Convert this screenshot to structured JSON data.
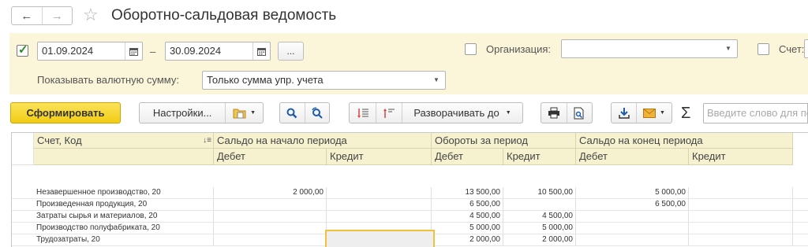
{
  "window": {
    "title": "Оборотно-сальдовая ведомость",
    "back_icon": "←",
    "forward_icon": "→",
    "star_icon": "☆"
  },
  "filters": {
    "period_from": "01.09.2024",
    "period_separator": "–",
    "period_to": "30.09.2024",
    "more_label": "...",
    "organization_label": "Организация:",
    "organization_value": "",
    "account_label": "Счет:",
    "currency_label": "Показывать валютную сумму:",
    "currency_value": "Только сумма упр. учета"
  },
  "toolbar": {
    "generate_label": "Сформировать",
    "settings_label": "Настройки...",
    "expand_label": "Разворачивать до",
    "sigma_label": "Σ",
    "search_placeholder": "Введите слово для поиска"
  },
  "grid": {
    "headers": {
      "account": "Счет, Код",
      "opening": "Сальдо на начало периода",
      "turnover": "Обороты за период",
      "closing": "Сальдо на конец периода",
      "debit": "Дебет",
      "credit": "Кредит"
    },
    "rows": [
      {
        "name": "Незавершенное производство, 20",
        "open_debit": "2 000,00",
        "open_credit": "",
        "turn_debit": "13 500,00",
        "turn_credit": "10 500,00",
        "close_debit": "5 000,00",
        "close_credit": ""
      },
      {
        "name": "Произведенная продукция, 20",
        "open_debit": "",
        "open_credit": "",
        "turn_debit": "6 500,00",
        "turn_credit": "",
        "close_debit": "6 500,00",
        "close_credit": ""
      },
      {
        "name": "Затраты сырья и материалов, 20",
        "open_debit": "",
        "open_credit": "",
        "turn_debit": "4 500,00",
        "turn_credit": "4 500,00",
        "close_debit": "",
        "close_credit": ""
      },
      {
        "name": "Производство полуфабриката, 20",
        "open_debit": "",
        "open_credit": "",
        "turn_debit": "5 000,00",
        "turn_credit": "5 000,00",
        "close_debit": "",
        "close_credit": ""
      },
      {
        "name": "Трудозатраты, 20",
        "open_debit": "",
        "open_credit": "",
        "turn_debit": "2 000,00",
        "turn_credit": "2 000,00",
        "close_debit": "",
        "close_credit": ""
      }
    ]
  },
  "colors": {
    "filter_panel": "#fbf6d9",
    "header_bg": "#f6f1cf",
    "primary_button": "#f2cc13",
    "selection_border": "#f0c23c"
  }
}
